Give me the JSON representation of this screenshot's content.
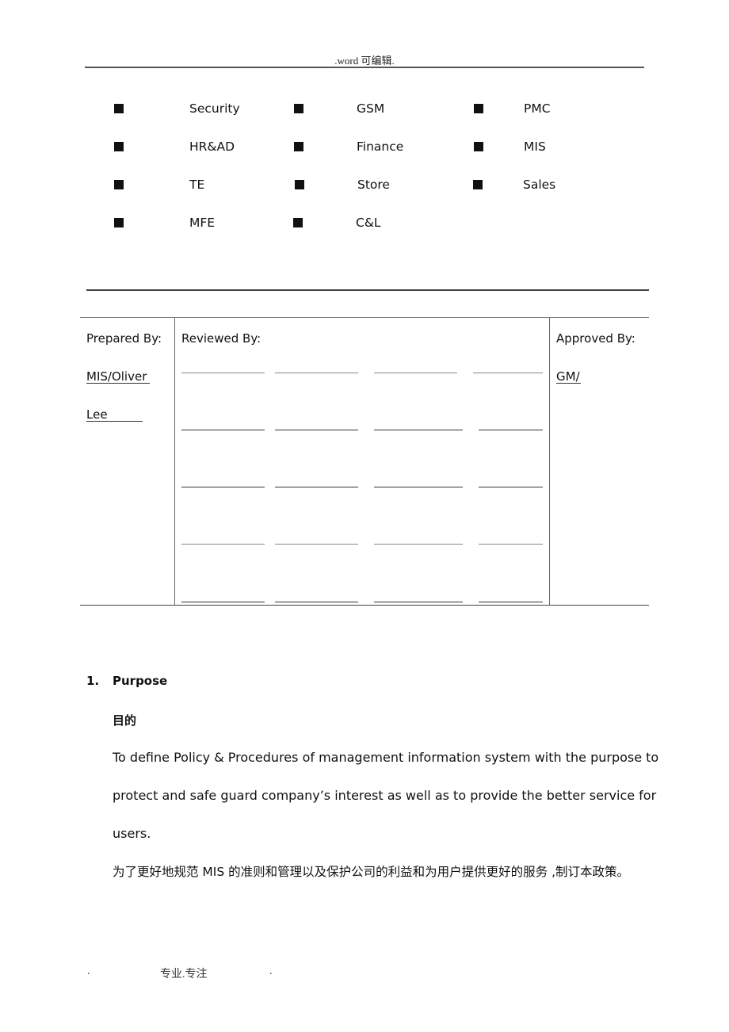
{
  "header": {
    "text": ".word 可编辑."
  },
  "distribution": {
    "bullet_icon": "black-square-icon",
    "items": [
      {
        "label": "Security"
      },
      {
        "label": "GSM"
      },
      {
        "label": "PMC"
      },
      {
        "label": "HR&AD"
      },
      {
        "label": "Finance"
      },
      {
        "label": "MIS"
      },
      {
        "label": "TE"
      },
      {
        "label": "Store"
      },
      {
        "label": "Sales"
      },
      {
        "label": "MFE"
      },
      {
        "label": "C&L"
      }
    ]
  },
  "signoff": {
    "prepared_label": "Prepared By:",
    "prepared_value_line1": "MIS/Oliver",
    "prepared_value_line2": "Lee",
    "reviewed_label": "Reviewed By:",
    "reviewed_rows": 5,
    "reviewed_columns": 4,
    "approved_label": "Approved By:",
    "approved_value": "GM/"
  },
  "section": {
    "number": "1.",
    "title": "Purpose",
    "title_cn": "目的",
    "para_line1": "To define Policy & Procedures of management information system with the purpose to",
    "para_line2": "protect and safe guard company’s interest as well as to provide the better service for",
    "para_line3": "users.",
    "para_cn": "为了更好地规范 MIS 的准则和管理以及保护公司的利益和为用户提供更好的服务 ,制订本政策。"
  },
  "footer": {
    "left": ".",
    "center": "专业.专注",
    "right": "."
  }
}
